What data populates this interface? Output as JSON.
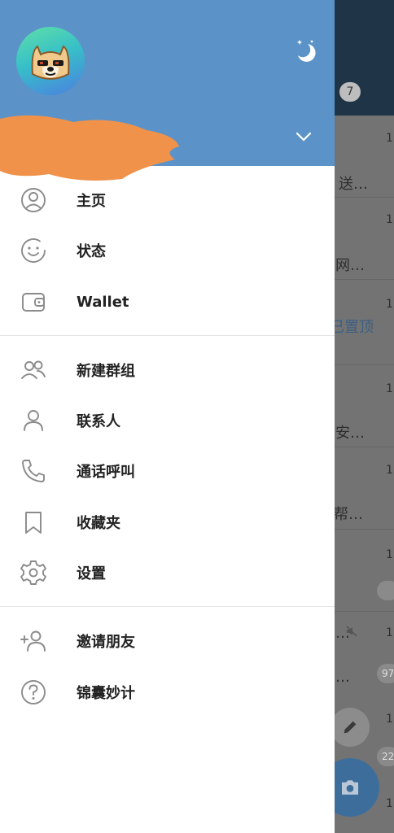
{
  "header": {
    "avatar_alt": "doge avatar",
    "night_mode_icon": "moon-stars-icon",
    "expand_icon": "chevron-down-icon"
  },
  "menu": {
    "home": "主页",
    "status": "状态",
    "wallet": "Wallet",
    "new_group": "新建群组",
    "contacts": "联系人",
    "calls": "通话呼叫",
    "saved": "收藏夹",
    "settings": "设置",
    "invite": "邀请朋友",
    "tips": "锦囊妙计"
  },
  "background": {
    "badge_count": "7",
    "snippets": [
      "送…",
      "网…",
      "已置顶",
      "安…",
      "帮…",
      "…",
      "…"
    ],
    "unread_counts": [
      "97",
      "22"
    ],
    "row_numbers": [
      "1",
      "1",
      "1",
      "1",
      "1",
      "1",
      "1",
      "1",
      "1",
      "1",
      "1"
    ]
  },
  "colors": {
    "header_blue": "#5b93c9",
    "accent_camera": "#3d6e9b",
    "redaction_orange": "#f0924a"
  }
}
